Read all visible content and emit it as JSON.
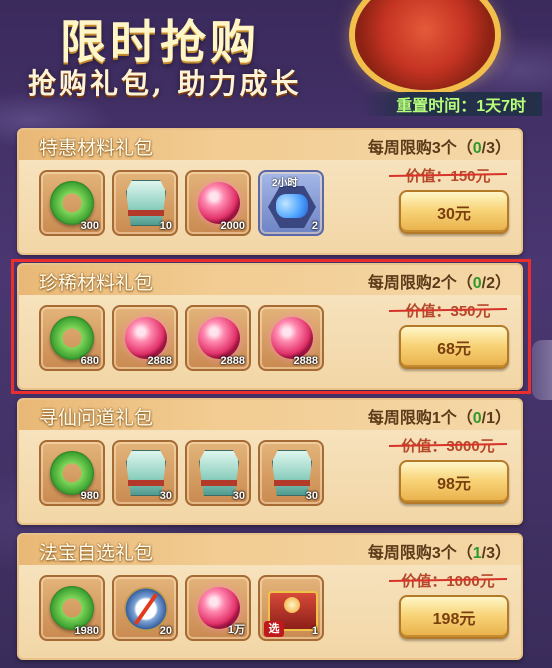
{
  "header": {
    "title": "限时抢购",
    "subtitle": "抢购礼包, 助力成长",
    "reset_label": "重置时间：1天7时"
  },
  "packs": [
    {
      "name": "特惠材料礼包",
      "limit_prefix": "每周限购3个（",
      "limit_count": "0",
      "limit_suffix": "/3）",
      "price_old": "价值：150元",
      "price": "30元",
      "items": [
        {
          "icon": "green-jade-icon",
          "qty": "300"
        },
        {
          "icon": "jade-armor-icon",
          "qty": "10"
        },
        {
          "icon": "pink-orb-icon",
          "qty": "2000"
        },
        {
          "icon": "blue-gems-icon",
          "qty": "2",
          "tag": "2小时"
        }
      ]
    },
    {
      "name": "珍稀材料礼包",
      "limit_prefix": "每周限购2个（",
      "limit_count": "0",
      "limit_suffix": "/2）",
      "price_old": "价值：350元",
      "price": "68元",
      "items": [
        {
          "icon": "green-jade-icon",
          "qty": "680"
        },
        {
          "icon": "pink-orb-icon",
          "qty": "2888"
        },
        {
          "icon": "pink-orb-icon",
          "qty": "2888"
        },
        {
          "icon": "pink-orb-icon",
          "qty": "2888"
        }
      ]
    },
    {
      "name": "寻仙问道礼包",
      "limit_prefix": "每周限购1个（",
      "limit_count": "0",
      "limit_suffix": "/1）",
      "price_old": "价值：3000元",
      "price": "98元",
      "items": [
        {
          "icon": "green-jade-icon",
          "qty": "980"
        },
        {
          "icon": "jade-armor-icon",
          "qty": "30"
        },
        {
          "icon": "jade-armor-icon",
          "qty": "30"
        },
        {
          "icon": "jade-armor-icon",
          "qty": "30"
        }
      ]
    },
    {
      "name": "法宝自选礼包",
      "limit_prefix": "每周限购3个（",
      "limit_count": "1",
      "limit_suffix": "/3）",
      "price_old": "价值：1000元",
      "price": "198元",
      "items": [
        {
          "icon": "green-jade-icon",
          "qty": "1980"
        },
        {
          "icon": "compass-icon",
          "qty": "20"
        },
        {
          "icon": "pink-orb-icon",
          "qty": "1万"
        },
        {
          "icon": "treasure-chest-icon",
          "qty": "1",
          "select_tag": "选"
        }
      ]
    }
  ],
  "colors": {
    "limit_count": "#2c9a2c",
    "highlight_border": "#ea2d2d",
    "reset_text": "#b6ff7a"
  }
}
